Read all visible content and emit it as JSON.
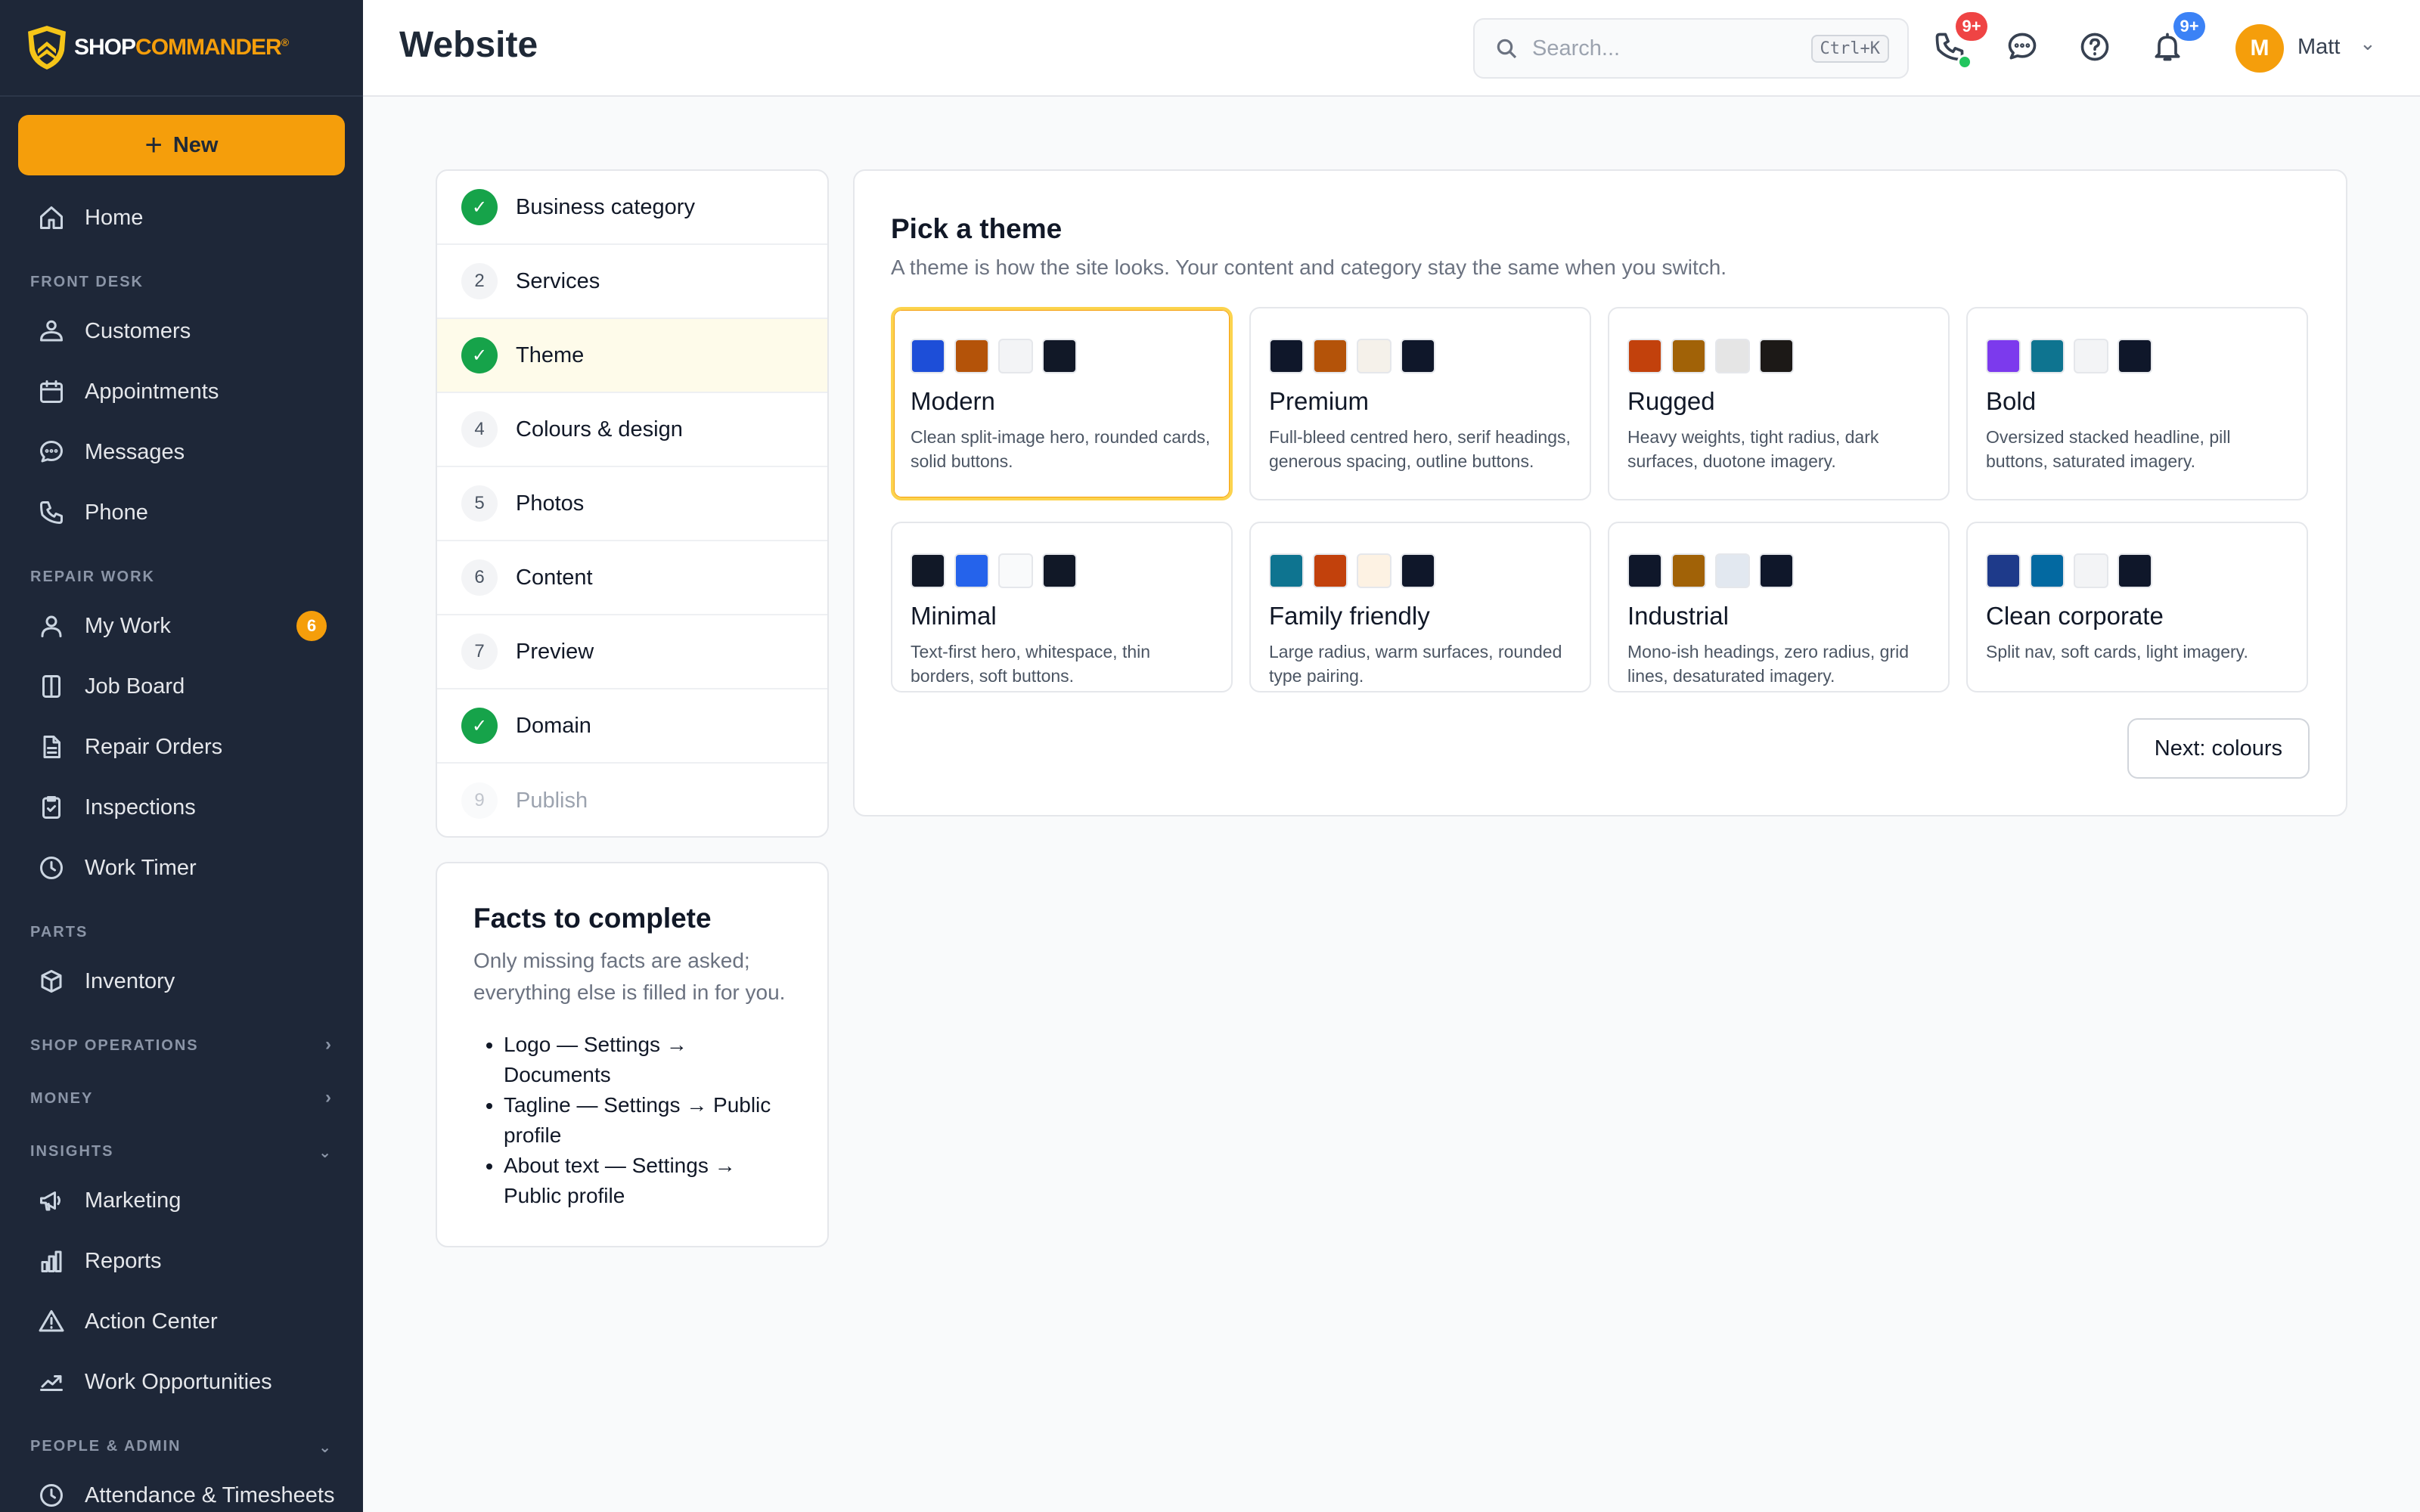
{
  "brand": {
    "name_part1": "SHOP",
    "name_part2": "COMMANDER",
    "mark": "®"
  },
  "sidebar": {
    "new_label": "New",
    "home": "Home",
    "sections": {
      "front_desk": "FRONT DESK",
      "repair_work": "REPAIR WORK",
      "parts": "PARTS",
      "shop_operations": "SHOP OPERATIONS",
      "money": "MONEY",
      "insights": "INSIGHTS",
      "people_admin": "PEOPLE & ADMIN"
    },
    "items": {
      "customers": "Customers",
      "appointments": "Appointments",
      "messages": "Messages",
      "phone": "Phone",
      "my_work": "My Work",
      "my_work_badge": "6",
      "job_board": "Job Board",
      "repair_orders": "Repair Orders",
      "inspections": "Inspections",
      "work_timer": "Work Timer",
      "inventory": "Inventory",
      "marketing": "Marketing",
      "reports": "Reports",
      "action_center": "Action Center",
      "work_opportunities": "Work Opportunities",
      "attendance": "Attendance & Timesheets"
    }
  },
  "header": {
    "title": "Website",
    "search_placeholder": "Search...",
    "search_shortcut": "Ctrl+K",
    "phone_badge": "9+",
    "bell_badge": "9+",
    "user_initial": "M",
    "user_name": "Matt"
  },
  "steps": [
    {
      "num": "✓",
      "label": "Business category",
      "state": "done"
    },
    {
      "num": "2",
      "label": "Services",
      "state": "todo"
    },
    {
      "num": "✓",
      "label": "Theme",
      "state": "active"
    },
    {
      "num": "4",
      "label": "Colours & design",
      "state": "todo"
    },
    {
      "num": "5",
      "label": "Photos",
      "state": "todo"
    },
    {
      "num": "6",
      "label": "Content",
      "state": "todo"
    },
    {
      "num": "7",
      "label": "Preview",
      "state": "todo"
    },
    {
      "num": "✓",
      "label": "Domain",
      "state": "done"
    },
    {
      "num": "9",
      "label": "Publish",
      "state": "muted"
    }
  ],
  "facts": {
    "title": "Facts to complete",
    "subtitle": "Only missing facts are asked; everything else is filled in for you.",
    "items": [
      "Logo — Settings → Documents",
      "Tagline — Settings → Public profile",
      "About text — Settings → Public profile"
    ]
  },
  "theme": {
    "title": "Pick a theme",
    "subtitle": "A theme is how the site looks. Your content and category stay the same when you switch.",
    "next_label": "Next: colours",
    "cards": [
      {
        "name": "Modern",
        "desc": "Clean split-image hero, rounded cards, solid buttons.",
        "swatches": [
          "#1d4ed8",
          "#b45309",
          "#f3f4f6",
          "#111827"
        ]
      },
      {
        "name": "Premium",
        "desc": "Full-bleed centred hero, serif headings, generous spacing, outline buttons.",
        "swatches": [
          "#0f172a",
          "#b45309",
          "#f5f1ea",
          "#0f172a"
        ]
      },
      {
        "name": "Rugged",
        "desc": "Heavy weights, tight radius, dark surfaces, duotone imagery.",
        "swatches": [
          "#c2410c",
          "#a16207",
          "#e5e5e5",
          "#1c1917"
        ]
      },
      {
        "name": "Bold",
        "desc": "Oversized stacked headline, pill buttons, saturated imagery.",
        "swatches": [
          "#7c3aed",
          "#0e7490",
          "#f3f4f6",
          "#0f172a"
        ]
      },
      {
        "name": "Minimal",
        "desc": "Text-first hero, whitespace, thin borders, soft buttons.",
        "swatches": [
          "#111827",
          "#2563eb",
          "#f9fafb",
          "#111827"
        ]
      },
      {
        "name": "Family friendly",
        "desc": "Large radius, warm surfaces, rounded type pairing.",
        "swatches": [
          "#0e7490",
          "#c2410c",
          "#fdf2e3",
          "#0f172a"
        ]
      },
      {
        "name": "Industrial",
        "desc": "Mono-ish headings, zero radius, grid lines, desaturated imagery.",
        "swatches": [
          "#0f172a",
          "#a16207",
          "#e2e8f0",
          "#0f172a"
        ]
      },
      {
        "name": "Clean corporate",
        "desc": "Split nav, soft cards, light imagery.",
        "swatches": [
          "#1e3a8a",
          "#0369a1",
          "#f3f4f6",
          "#0f172a"
        ]
      }
    ]
  },
  "colors": {
    "accent": "#f59e0b",
    "sidebar_bg": "#1e2738",
    "success": "#16a34a"
  }
}
